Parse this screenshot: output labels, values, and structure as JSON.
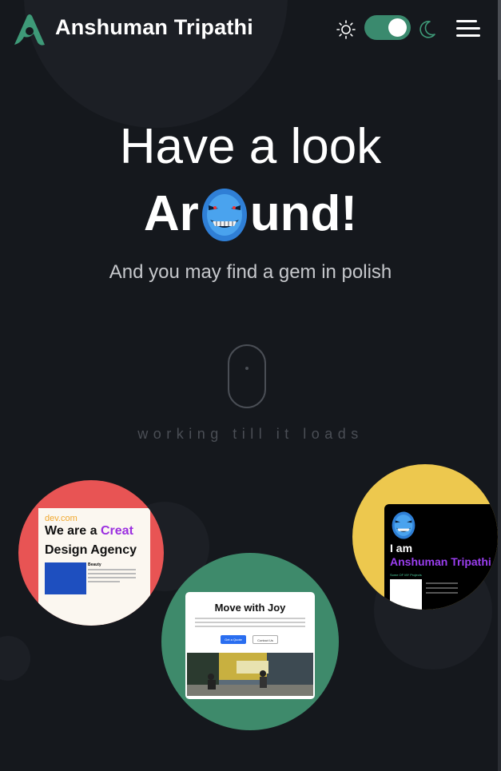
{
  "header": {
    "brand": "Anshuman Tripathi",
    "logo_icon": "logo-a-icon",
    "theme_toggle": {
      "light_icon": "sun-icon",
      "dark_icon": "moon-icon",
      "state": "on"
    },
    "menu_icon": "hamburger-menu-icon"
  },
  "hero": {
    "line1": "Have a look",
    "line2_start": "Ar",
    "line2_end": "und!",
    "subtitle": "And you may find a gem in polish"
  },
  "scroll_indicator": {
    "icon": "mouse-scroll-icon",
    "text": "working till it loads"
  },
  "projects": [
    {
      "color": "#e85454",
      "site": "dev.com",
      "heading_line1": "We are a",
      "heading_accent": "Creat",
      "heading_line2": "Design Agency",
      "caption": "Beauty"
    },
    {
      "color": "#3e8a6b",
      "title": "Move with Joy",
      "primary_button": "Get a Quote",
      "secondary_button": "Contact Us"
    },
    {
      "color": "#edc84e",
      "intro": "I am",
      "name": "Anshuman Tripathi",
      "section": "Some OF MY Projects"
    }
  ],
  "colors": {
    "background": "#15181d",
    "accent": "#3a8a6e",
    "text_secondary": "#c6c8cc"
  }
}
